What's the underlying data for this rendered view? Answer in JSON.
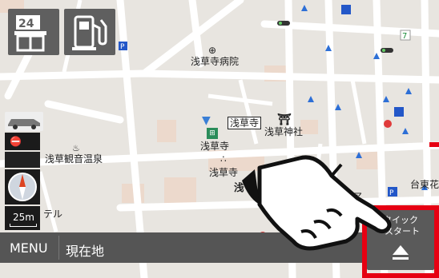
{
  "top_buttons": {
    "convenience_store_icon": "24",
    "gas_station_icon": "fuel-pump"
  },
  "map_labels": {
    "hospital": "浅草寺病院",
    "sensoji_box": "浅草寺",
    "sensoji_1": "浅草寺",
    "sensoji_2": "浅草寺",
    "shrine": "浅草神社",
    "onsen": "浅草観音温泉",
    "partial_asa": "浅",
    "partial_te": "テル",
    "taito": "台東花",
    "partial_shi": "シア"
  },
  "scale": {
    "label": "25m"
  },
  "bottom_bar": {
    "menu_label": "MENU",
    "current_location_label": "現在地"
  },
  "quick_start": {
    "label_line1": "クイック",
    "label_line2": "スタート"
  },
  "colors": {
    "road_white": "#ffffff",
    "block_orange": "#f2d5c5",
    "highlight_red": "#e60012"
  }
}
